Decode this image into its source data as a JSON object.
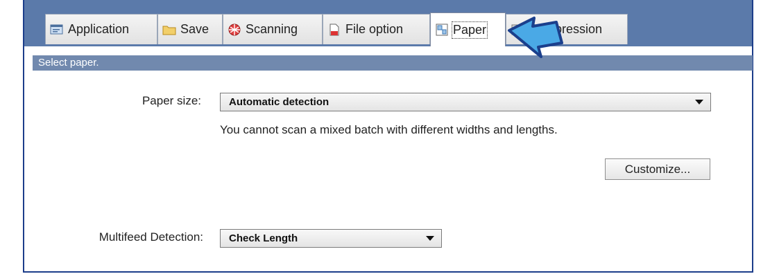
{
  "tabs": [
    {
      "label": "Application",
      "icon": "application-icon"
    },
    {
      "label": "Save",
      "icon": "folder-icon"
    },
    {
      "label": "Scanning",
      "icon": "scanning-icon"
    },
    {
      "label": "File option",
      "icon": "file-icon"
    },
    {
      "label": "Paper",
      "icon": "paper-icon"
    },
    {
      "label": "Compression",
      "icon": "compression-icon"
    }
  ],
  "active_tab": "Paper",
  "section_header": "Select paper.",
  "paper_size": {
    "label": "Paper size:",
    "value": "Automatic detection",
    "note": "You cannot scan a mixed batch with different widths and lengths."
  },
  "customize_button": "Customize...",
  "multifeed": {
    "label": "Multifeed Detection:",
    "value": "Check Length"
  },
  "colors": {
    "tab_strip": "#5b7aaa",
    "section_header": "#7189ae",
    "frame_border": "#1c3d8a",
    "pointer_fill": "#4aa9e6",
    "pointer_stroke": "#1b3f8c"
  }
}
